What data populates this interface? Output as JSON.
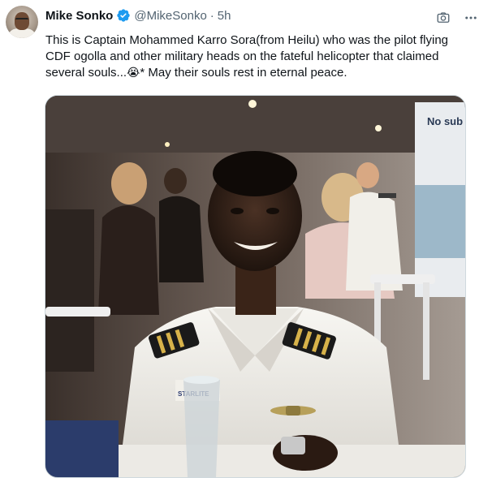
{
  "author": {
    "display_name": "Mike Sonko",
    "handle": "@MikeSonko",
    "separator": "·",
    "time": "5h",
    "verified": true
  },
  "tweet": {
    "text_part1": "This is Captain Mohammed Karro Sora(from Heilu) who was the pilot flying CDF ogolla and other military heads on the fateful helicopter that claimed several souls...",
    "emoji": "😭",
    "text_part2": "* May their souls rest in eternal peace."
  },
  "media": {
    "sign_text": "No sub",
    "wing_text": "STARLITE"
  },
  "icons": {
    "verified": "verified-badge-icon",
    "grok": "grok-icon",
    "more": "more-options-icon"
  },
  "colors": {
    "verified_blue": "#1d9bf0",
    "secondary_text": "#536471"
  }
}
